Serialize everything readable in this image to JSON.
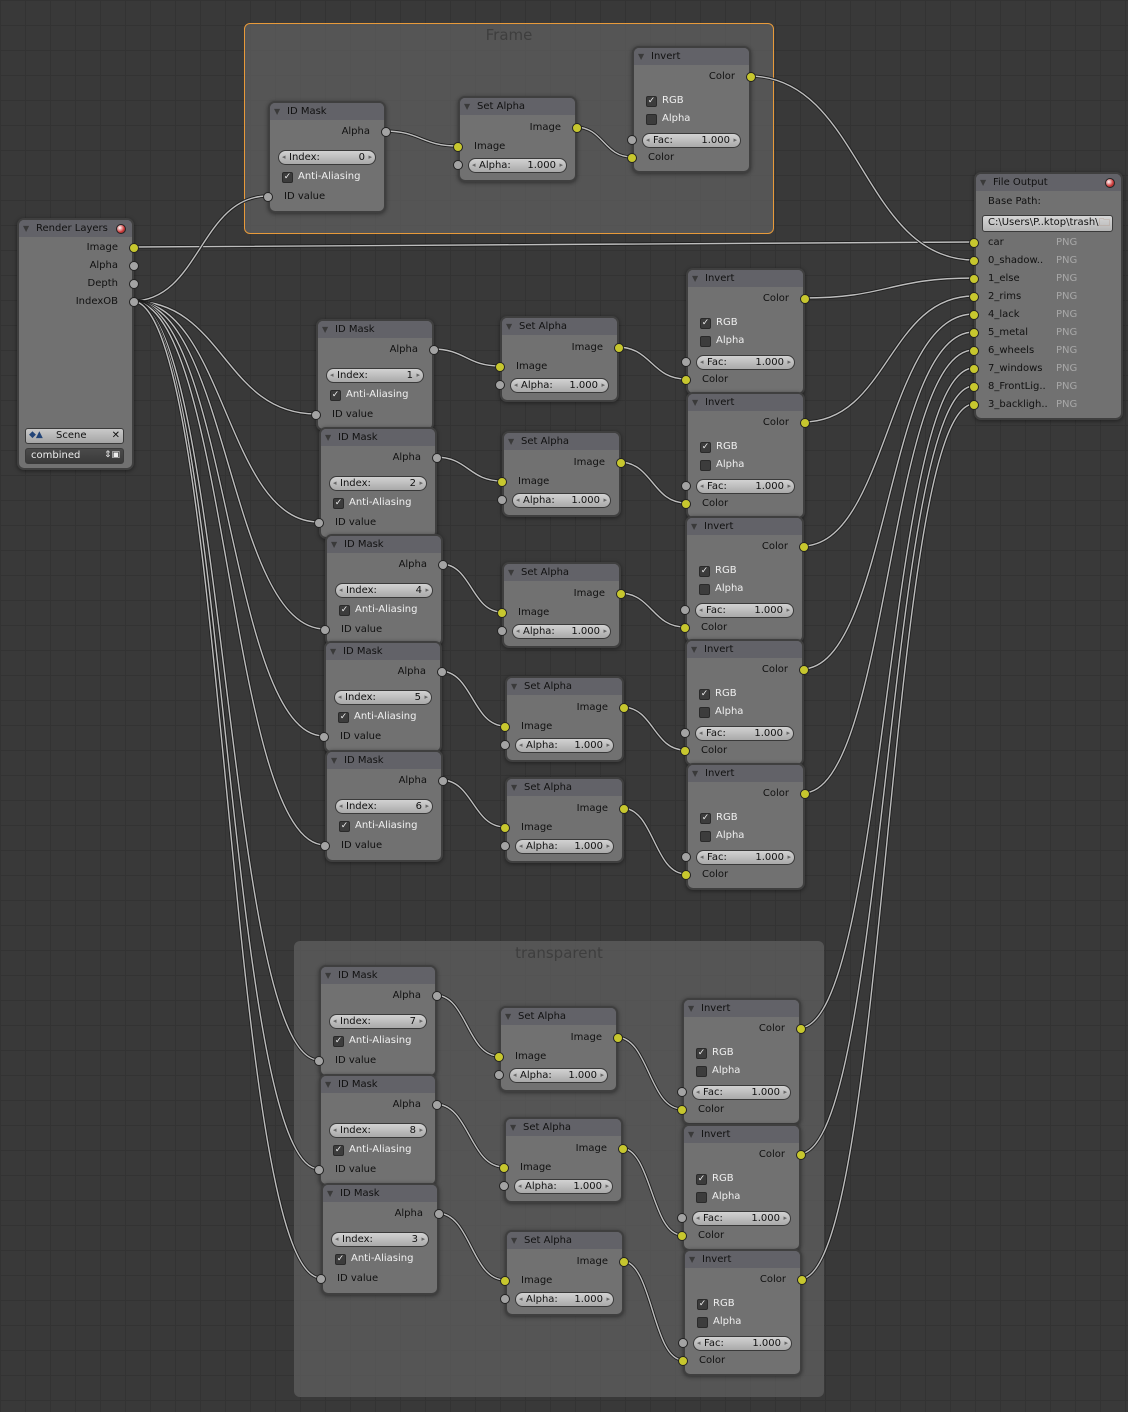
{
  "editor": {
    "background": "#393939",
    "socket_color_yellow": "#c7c72e",
    "socket_color_gray": "#a3a3a3",
    "frame_selected_color": "#e89a3a"
  },
  "frames": [
    {
      "label": "Frame",
      "selected": true
    },
    {
      "label": "transparent",
      "selected": false
    }
  ],
  "render_layers": {
    "title": "Render Layers",
    "outputs": [
      "Image",
      "Alpha",
      "Depth",
      "IndexOB"
    ],
    "scene": "Scene",
    "layer": "combined"
  },
  "file_output": {
    "title": "File Output",
    "base_path_label": "Base Path:",
    "base_path": "C:\\Users\\P..ktop\\trash\\",
    "inputs": [
      {
        "name": "car",
        "format": "PNG"
      },
      {
        "name": "0_shadow..",
        "format": "PNG"
      },
      {
        "name": "1_else",
        "format": "PNG"
      },
      {
        "name": "2_rims",
        "format": "PNG"
      },
      {
        "name": "4_lack",
        "format": "PNG"
      },
      {
        "name": "5_metal",
        "format": "PNG"
      },
      {
        "name": "6_wheels",
        "format": "PNG"
      },
      {
        "name": "7_windows",
        "format": "PNG"
      },
      {
        "name": "8_FrontLig..",
        "format": "PNG"
      },
      {
        "name": "3_backligh..",
        "format": "PNG"
      }
    ]
  },
  "labels": {
    "id_mask": {
      "title": "ID Mask",
      "output": "Alpha",
      "index": "Index:",
      "anti_aliasing": "Anti-Aliasing",
      "input": "ID value"
    },
    "set_alpha": {
      "title": "Set Alpha",
      "output": "Image",
      "input": "Image",
      "alpha": "Alpha:"
    },
    "invert": {
      "title": "Invert",
      "output": "Color",
      "rgb": "RGB",
      "alpha": "Alpha",
      "fac": "Fac:",
      "input": "Color"
    }
  },
  "chains": [
    {
      "index": "0",
      "anti_aliasing": true,
      "alpha": "1.000",
      "rgb": true,
      "invert_alpha": false,
      "fac": "1.000",
      "frame": "Frame"
    },
    {
      "index": "1",
      "anti_aliasing": true,
      "alpha": "1.000",
      "rgb": true,
      "invert_alpha": false,
      "fac": "1.000"
    },
    {
      "index": "2",
      "anti_aliasing": true,
      "alpha": "1.000",
      "rgb": true,
      "invert_alpha": false,
      "fac": "1.000"
    },
    {
      "index": "4",
      "anti_aliasing": true,
      "alpha": "1.000",
      "rgb": true,
      "invert_alpha": false,
      "fac": "1.000"
    },
    {
      "index": "5",
      "anti_aliasing": true,
      "alpha": "1.000",
      "rgb": true,
      "invert_alpha": false,
      "fac": "1.000"
    },
    {
      "index": "6",
      "anti_aliasing": true,
      "alpha": "1.000",
      "rgb": true,
      "invert_alpha": false,
      "fac": "1.000"
    },
    {
      "index": "7",
      "anti_aliasing": true,
      "alpha": "1.000",
      "rgb": true,
      "invert_alpha": false,
      "fac": "1.000",
      "frame": "transparent"
    },
    {
      "index": "8",
      "anti_aliasing": true,
      "alpha": "1.000",
      "rgb": true,
      "invert_alpha": false,
      "fac": "1.000",
      "frame": "transparent"
    },
    {
      "index": "3",
      "anti_aliasing": true,
      "alpha": "1.000",
      "rgb": true,
      "invert_alpha": false,
      "fac": "1.000",
      "frame": "transparent"
    }
  ]
}
